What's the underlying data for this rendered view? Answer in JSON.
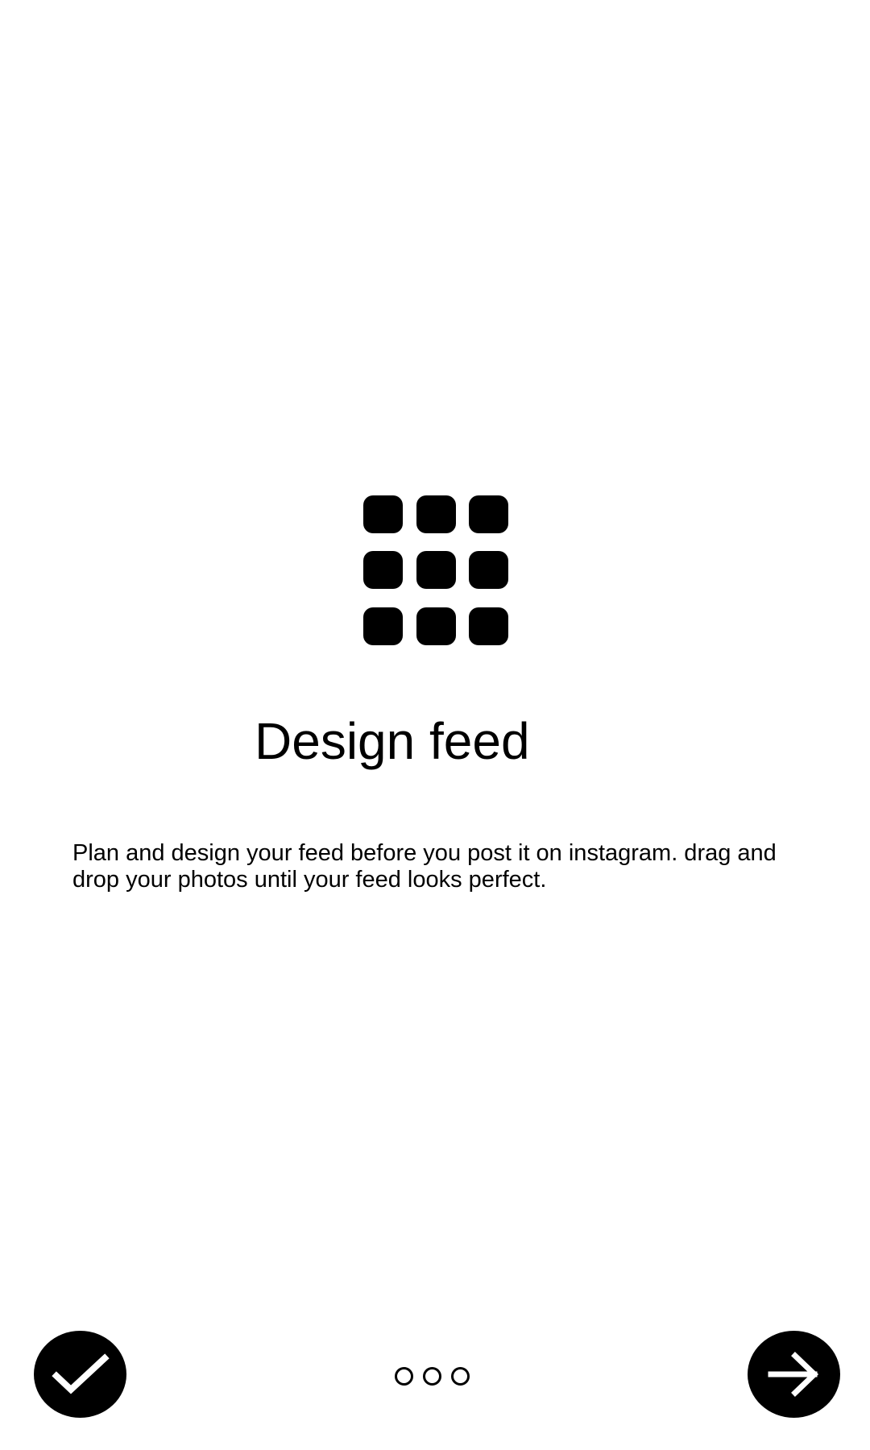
{
  "onboarding": {
    "title": "Design feed",
    "description": "Plan and design your feed before you post it on instagram. drag and drop your photos until your feed looks perfect.",
    "icon": "grid-icon",
    "current_page": 1,
    "total_pages": 3
  },
  "controls": {
    "done_icon": "checkmark-icon",
    "next_icon": "arrow-right-icon"
  },
  "colors": {
    "background": "#ffffff",
    "foreground": "#000000"
  }
}
